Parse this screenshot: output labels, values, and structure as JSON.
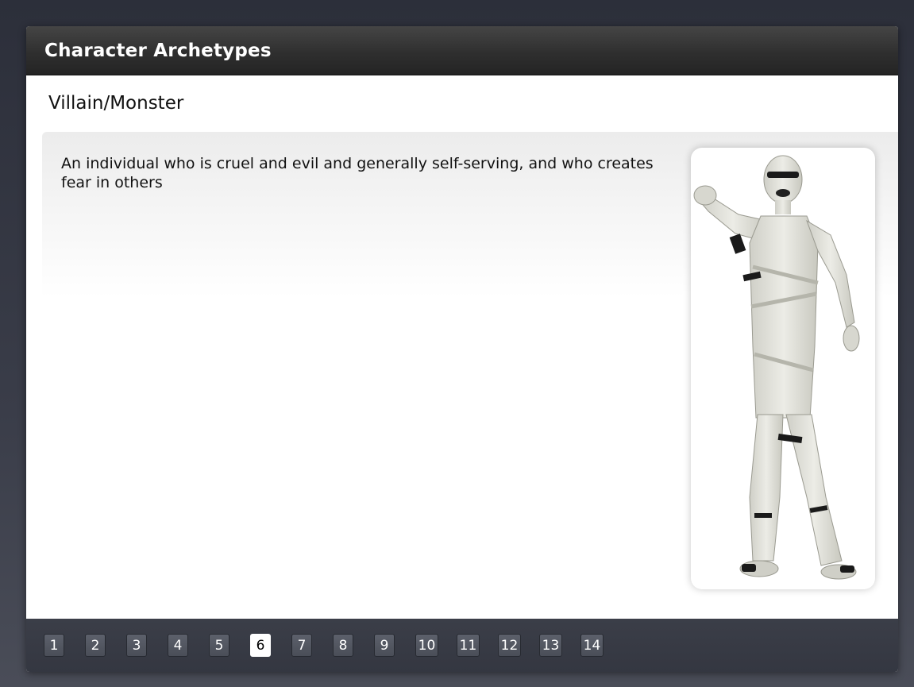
{
  "window": {
    "title": "Character Archetypes"
  },
  "slide": {
    "subtitle": "Villain/Monster",
    "description": "An individual who is cruel and evil and generally self-serving, and who creates fear in others",
    "image_subject": "mummy-costume-figure"
  },
  "pagination": {
    "pages": [
      "1",
      "2",
      "3",
      "4",
      "5",
      "6",
      "7",
      "8",
      "9",
      "10",
      "11",
      "12",
      "13",
      "14"
    ],
    "current": "6"
  },
  "colors": {
    "title_bar": "#2f2f2f",
    "nav_bar": "#3b3e48",
    "page_button": "#52565f",
    "active_page": "#ffffff"
  }
}
